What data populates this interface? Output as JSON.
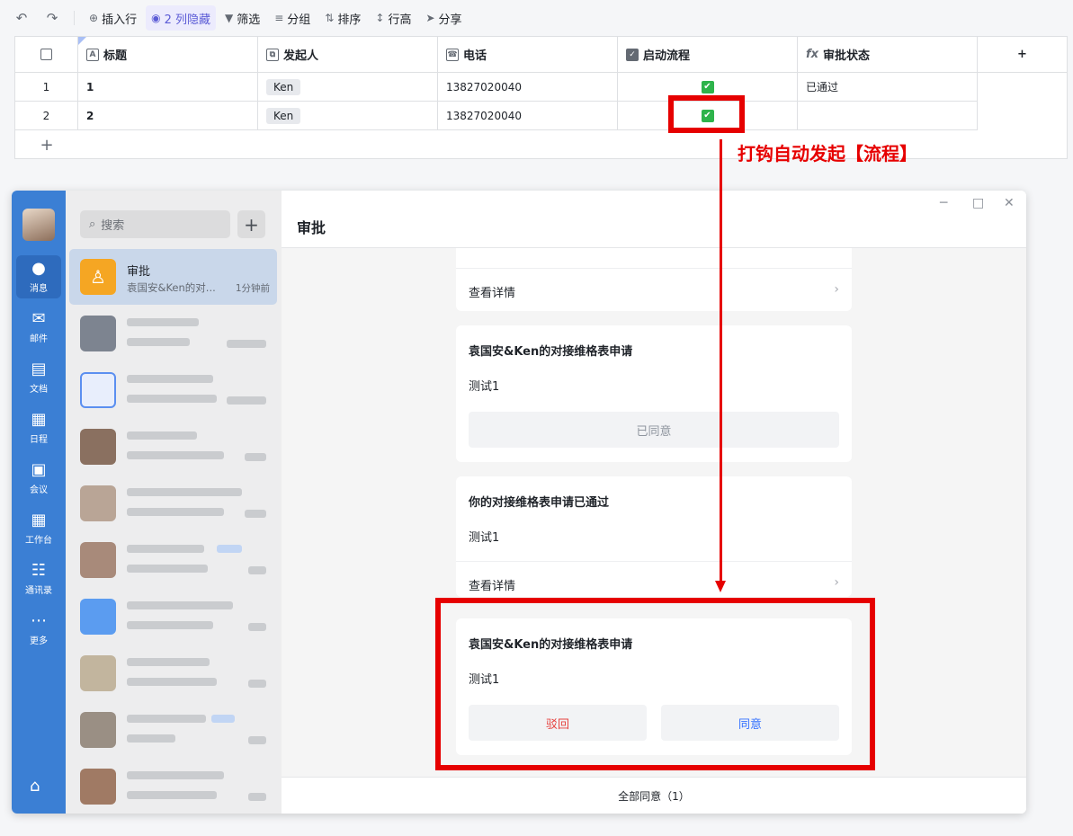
{
  "toolbar": {
    "undo_icon": "undo-icon",
    "redo_icon": "redo-icon",
    "insert_row": "插入行",
    "hidden_cols": "2 列隐藏",
    "filter": "筛选",
    "group": "分组",
    "sort": "排序",
    "row_height": "行高",
    "share": "分享"
  },
  "table": {
    "headers": [
      "标题",
      "发起人",
      "电话",
      "启动流程",
      "审批状态"
    ],
    "rows": [
      {
        "index": "1",
        "title": "1",
        "initiator": "Ken",
        "phone": "13827020040",
        "start_flow": true,
        "status": "已通过"
      },
      {
        "index": "2",
        "title": "2",
        "initiator": "Ken",
        "phone": "13827020040",
        "start_flow": true,
        "status": ""
      }
    ],
    "add_row": "+",
    "add_col": "+"
  },
  "annotation": {
    "text": "打钩自动发起【流程】",
    "color": "#e60000"
  },
  "app": {
    "rail": [
      {
        "label": "消息",
        "icon": "chat-icon"
      },
      {
        "label": "邮件",
        "icon": "mail-icon"
      },
      {
        "label": "文档",
        "icon": "doc-icon"
      },
      {
        "label": "日程",
        "icon": "calendar-icon"
      },
      {
        "label": "会议",
        "icon": "meeting-icon"
      },
      {
        "label": "工作台",
        "icon": "workbench-icon"
      },
      {
        "label": "通讯录",
        "icon": "contacts-icon"
      },
      {
        "label": "更多",
        "icon": "more-icon"
      }
    ],
    "search_placeholder": "搜索",
    "selected_chat": {
      "name": "审批",
      "preview": "袁国安&Ken的对...",
      "time": "1分钟前"
    },
    "main_title": "审批",
    "cards": {
      "c1": {
        "link": "查看详情"
      },
      "c2": {
        "title": "袁国安&Ken的对接维格表申请",
        "body": "测试1",
        "button": "已同意"
      },
      "c3": {
        "title": "你的对接维格表申请已通过",
        "body": "测试1",
        "link": "查看详情"
      },
      "c4": {
        "title": "袁国安&Ken的对接维格表申请",
        "body": "测试1",
        "reject": "驳回",
        "approve": "同意"
      }
    },
    "footer": "全部同意（1）"
  },
  "colors": {
    "accent": "#5b5bd6",
    "rail": "#3b7fd4",
    "reject": "#e64340",
    "approve": "#3370ff",
    "check": "#2eb34b"
  }
}
